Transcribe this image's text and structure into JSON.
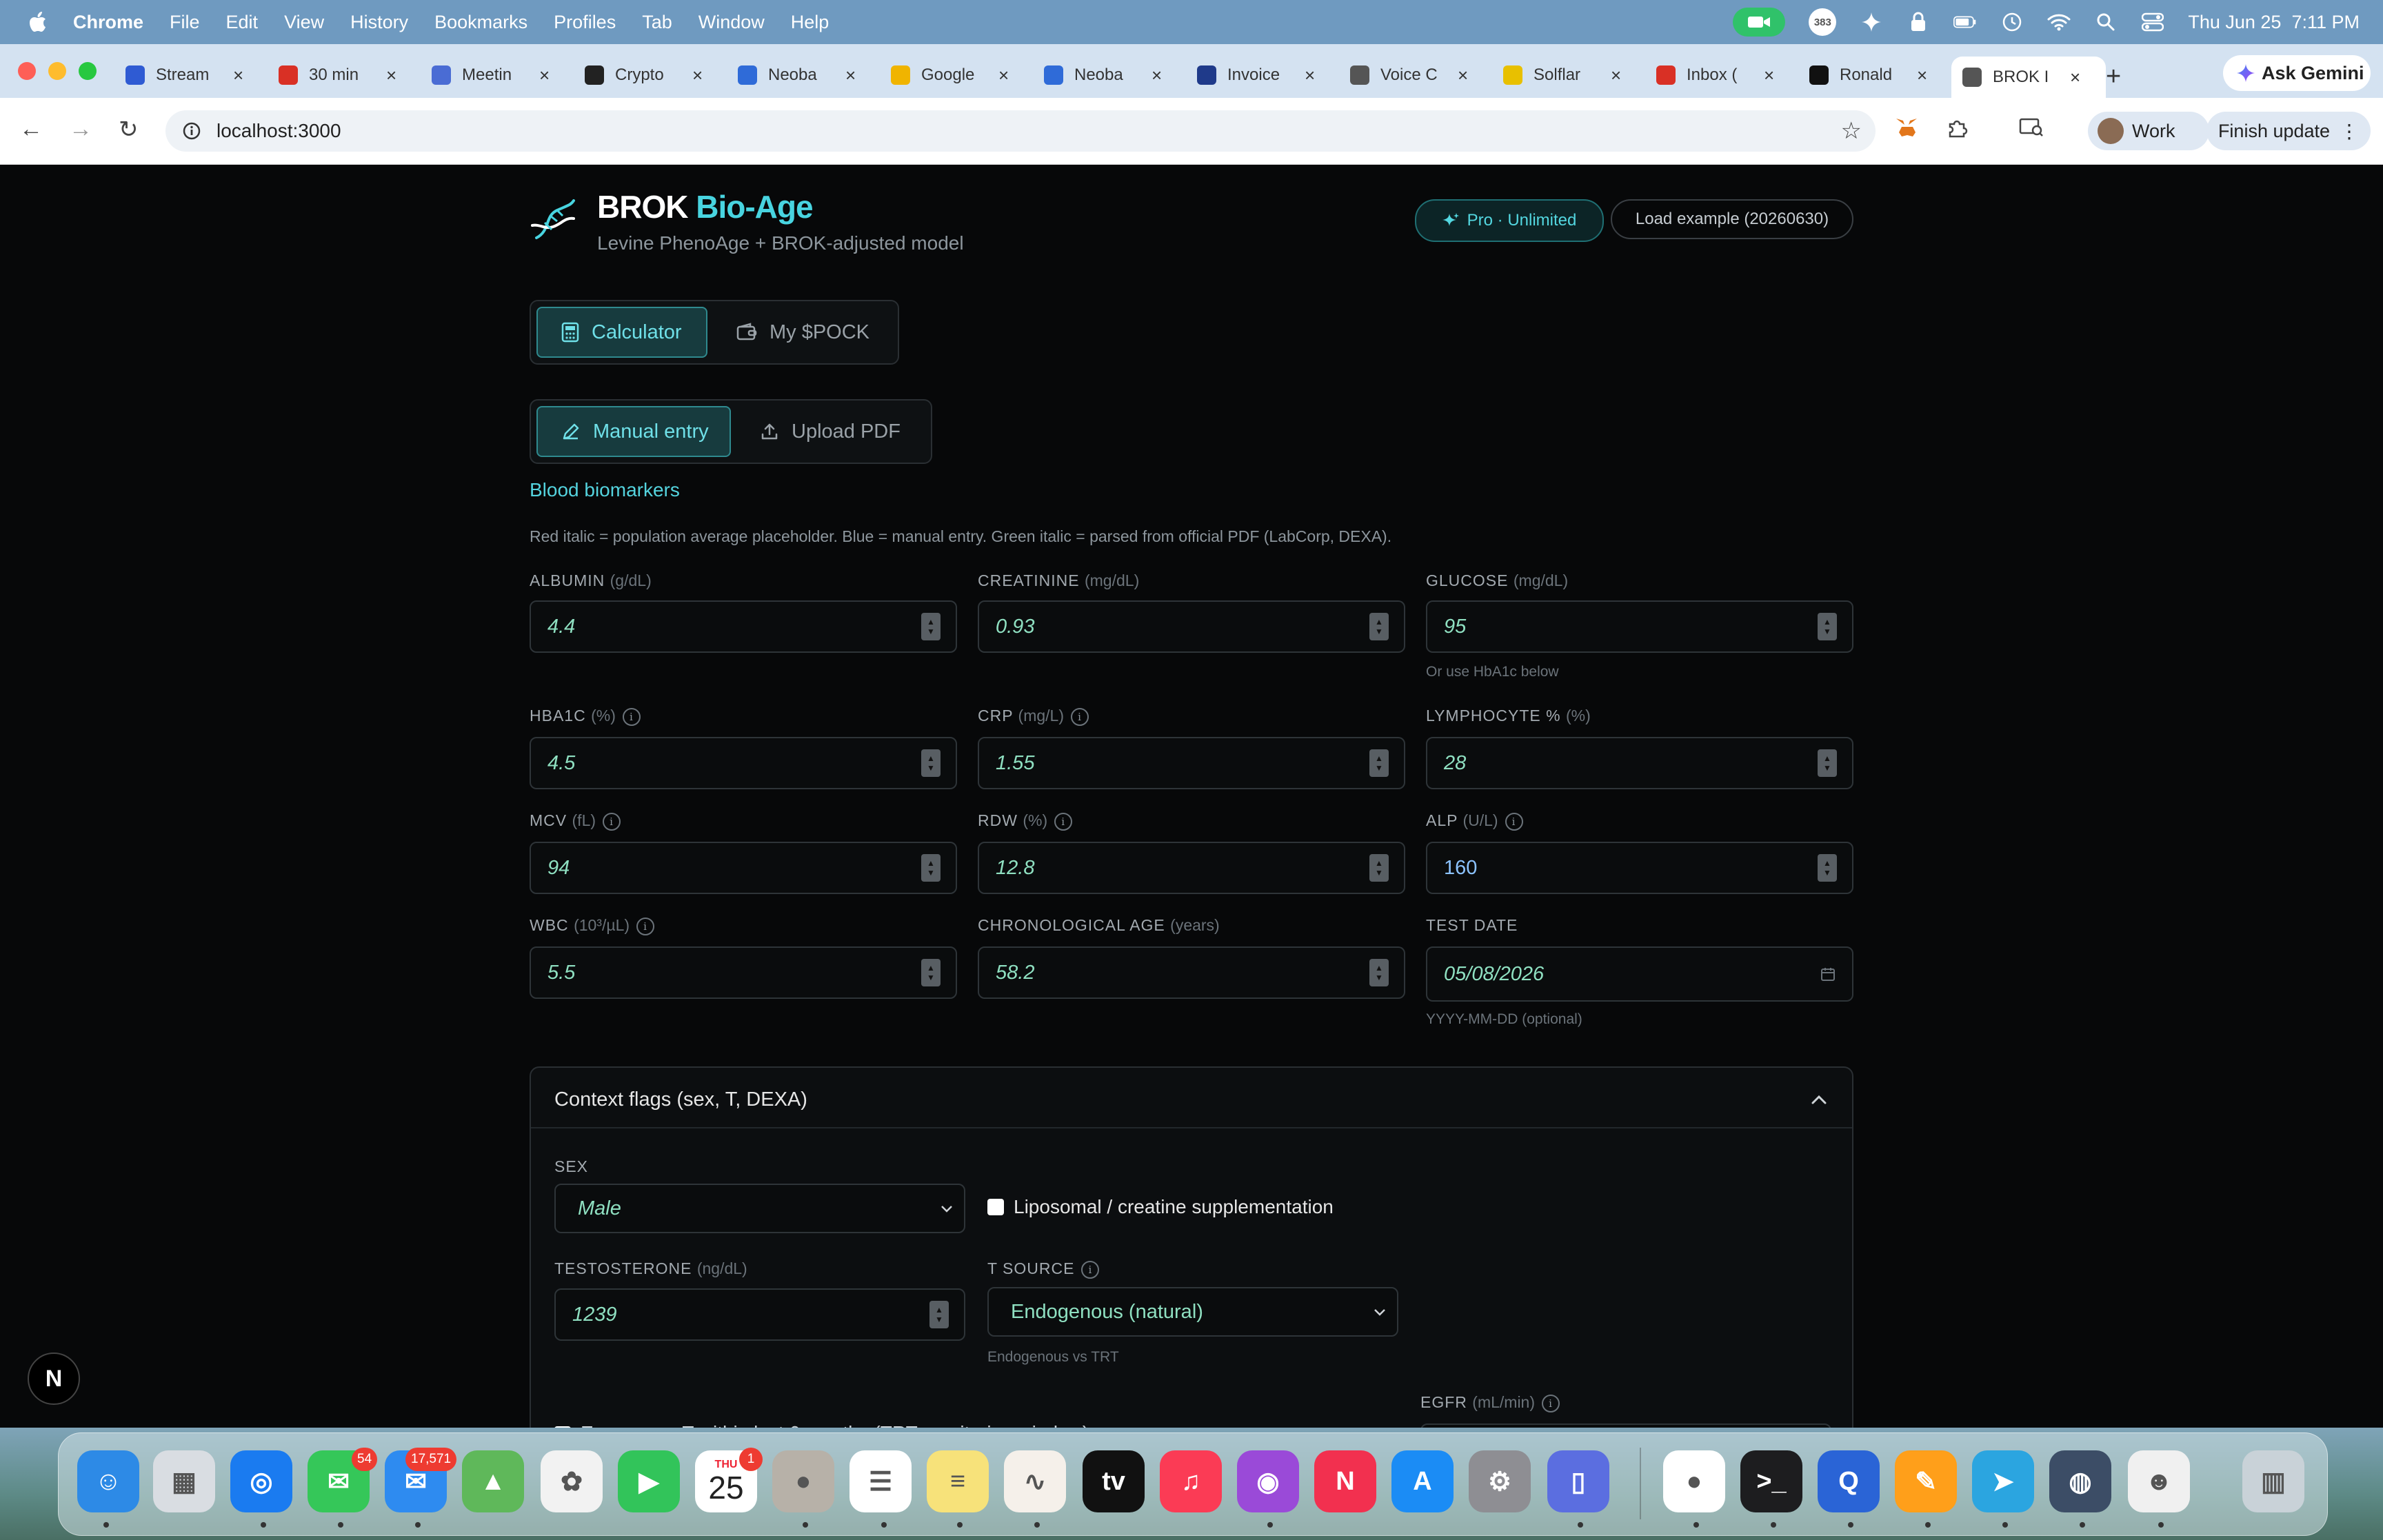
{
  "menubar": {
    "app_name": "Chrome",
    "items": [
      "File",
      "Edit",
      "View",
      "History",
      "Bookmarks",
      "Profiles",
      "Tab",
      "Window",
      "Help"
    ],
    "badge_count": "383",
    "datetime": "Thu Jun 25  7:11 PM"
  },
  "tabs": [
    {
      "label": "Stream",
      "icon": "stream-icon",
      "color": "#2f5bd3"
    },
    {
      "label": "30 min",
      "icon": "gmail-icon",
      "color": "#d93025"
    },
    {
      "label": "Meetin",
      "icon": "meeting-icon",
      "color": "#4a6cd4"
    },
    {
      "label": "Crypto",
      "icon": "gemini-spark-icon",
      "color": "#222222"
    },
    {
      "label": "Neoba",
      "icon": "calendar-icon",
      "color": "#2f6bd8"
    },
    {
      "label": "Google",
      "icon": "drive-folder-icon",
      "color": "#f0b400"
    },
    {
      "label": "Neoba",
      "icon": "calendar-icon",
      "color": "#2f6bd8"
    },
    {
      "label": "Invoice",
      "icon": "paypal-icon",
      "color": "#1f3a8a"
    },
    {
      "label": "Voice C",
      "icon": "globe-icon",
      "color": "#555555"
    },
    {
      "label": "Solflar",
      "icon": "solflare-icon",
      "color": "#e8c000"
    },
    {
      "label": "Inbox (",
      "icon": "gmail-icon",
      "color": "#d93025"
    },
    {
      "label": "Ronald",
      "icon": "g-icon",
      "color": "#111111"
    },
    {
      "label": "BROK I",
      "icon": "globe-icon",
      "color": "#555555",
      "active": true
    }
  ],
  "chrome": {
    "ask_gemini": "Ask Gemini",
    "url": "localhost:3000",
    "profile": "Work",
    "finish_update": "Finish update"
  },
  "app": {
    "brand_main": "BROK",
    "brand_accent": "Bio-Age",
    "subtitle": "Levine PhenoAge + BROK-adjusted model",
    "pro_badge": "Pro · Unlimited",
    "load_example": "Load example (20260630)",
    "nav": {
      "calculator": "Calculator",
      "wallet": "My $POCK"
    },
    "entry": {
      "manual": "Manual entry",
      "upload": "Upload PDF"
    },
    "section_title": "Blood biomarkers",
    "legend": "Red italic = population average placeholder. Blue = manual entry. Green italic = parsed from official PDF (LabCorp, DEXA).",
    "fields": {
      "albumin": {
        "label": "ALBUMIN",
        "unit": "(g/dL)",
        "value": "4.4"
      },
      "creatinine": {
        "label": "CREATININE",
        "unit": "(mg/dL)",
        "value": "0.93"
      },
      "glucose": {
        "label": "GLUCOSE",
        "unit": "(mg/dL)",
        "value": "95",
        "hint": "Or use HbA1c below"
      },
      "hba1c": {
        "label": "HBA1C",
        "unit": "(%)",
        "value": "4.5"
      },
      "crp": {
        "label": "CRP",
        "unit": "(mg/L)",
        "value": "1.55"
      },
      "lymphocyte": {
        "label": "LYMPHOCYTE %",
        "unit": "(%)",
        "value": "28"
      },
      "mcv": {
        "label": "MCV",
        "unit": "(fL)",
        "value": "94"
      },
      "rdw": {
        "label": "RDW",
        "unit": "(%)",
        "value": "12.8"
      },
      "alp": {
        "label": "ALP",
        "unit": "(U/L)",
        "value": "160"
      },
      "wbc": {
        "label": "WBC",
        "unit": "(10³/µL)",
        "value": "5.5"
      },
      "chrono_age": {
        "label": "CHRONOLOGICAL AGE",
        "unit": "(years)",
        "value": "58.2"
      },
      "test_date": {
        "label": "TEST DATE",
        "value": "05/08/2026",
        "hint": "YYYY-MM-DD (optional)"
      }
    },
    "context": {
      "title": "Context flags (sex, T, DEXA)",
      "sex_label": "SEX",
      "sex_value": "Male",
      "liposomal_label": "Liposomal / creatine supplementation",
      "testosterone_label": "TESTOSTERONE",
      "testosterone_unit": "(ng/dL)",
      "testosterone_value": "1239",
      "t_source_label": "T SOURCE",
      "t_source_value": "Endogenous (natural)",
      "t_source_hint": "Endogenous vs TRT",
      "egfr_label": "EGFR",
      "egfr_unit": "(mL/min)",
      "exogenous_label": "Exogenous T within last 6 months (TRT monitoring window)"
    }
  },
  "dock": {
    "badges": {
      "messages": "54",
      "mail": "17,571",
      "calendar": "1"
    },
    "calendar_month": "THU",
    "calendar_day": "25",
    "items": [
      "finder-icon",
      "launchpad-icon",
      "safari-icon",
      "messages-icon",
      "mail-icon",
      "maps-icon",
      "photos-icon",
      "facetime-icon",
      "calendar-icon",
      "contacts-icon",
      "reminders-icon",
      "notes-icon",
      "freeform-icon",
      "tv-icon",
      "music-icon",
      "podcasts-icon",
      "news-icon",
      "app-store-icon",
      "settings-icon",
      "iphone-mirroring-icon",
      "chrome-icon",
      "terminal-icon",
      "quicktime-icon",
      "pages-icon",
      "telegram-icon",
      "disk-utility-icon",
      "avatar-app-icon",
      "trash-icon"
    ]
  },
  "colors": {
    "accent": "#48d4e0",
    "parsed_value": "#8fe0c1",
    "manual_value": "#8cc3ff",
    "page_bg": "#070809"
  }
}
